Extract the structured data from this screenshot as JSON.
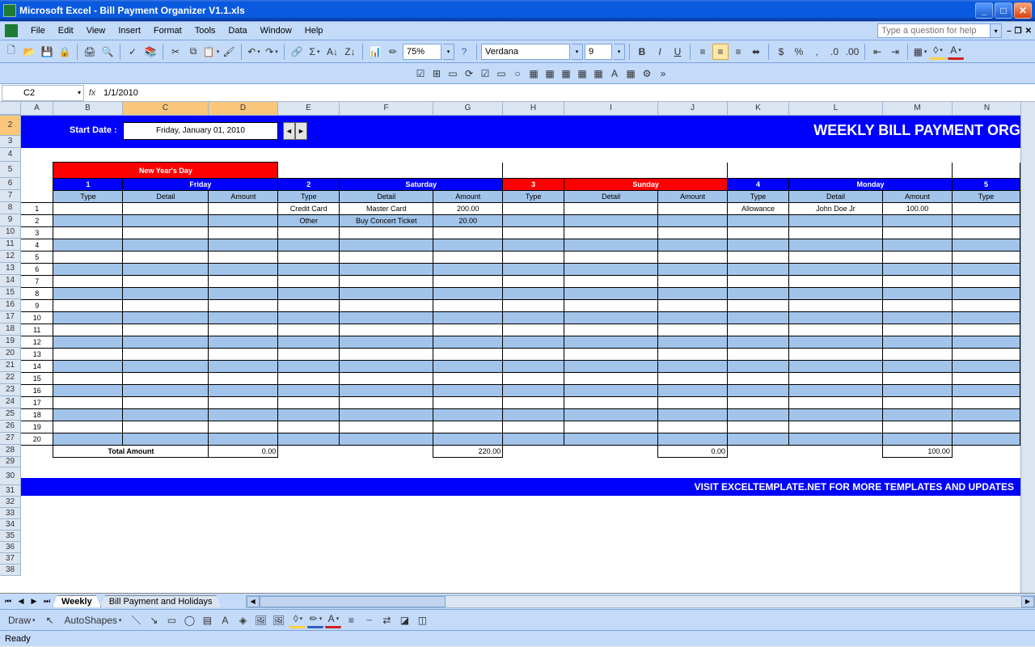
{
  "title": "Microsoft Excel - Bill Payment Organizer V1.1.xls",
  "menus": {
    "file": "File",
    "edit": "Edit",
    "view": "View",
    "insert": "Insert",
    "format": "Format",
    "tools": "Tools",
    "data": "Data",
    "window": "Window",
    "help": "Help"
  },
  "help_placeholder": "Type a question for help",
  "font_name": "Verdana",
  "font_size": "9",
  "zoom": "75%",
  "namebox": "C2",
  "formula": "1/1/2010",
  "columns": [
    "A",
    "B",
    "C",
    "D",
    "E",
    "F",
    "G",
    "H",
    "I",
    "J",
    "K",
    "L",
    "M",
    "N"
  ],
  "selected_cols": [
    "C",
    "D"
  ],
  "banner": {
    "start_label": "Start Date :",
    "start_value": "Friday, January 01, 2010",
    "title": "WEEKLY BILL PAYMENT ORG"
  },
  "holiday": {
    "col1": "New Year's Day"
  },
  "days": [
    {
      "num": "1",
      "name": "Friday",
      "weekend": false
    },
    {
      "num": "2",
      "name": "Saturday",
      "weekend": false
    },
    {
      "num": "3",
      "name": "Sunday",
      "weekend": true
    },
    {
      "num": "4",
      "name": "Monday",
      "weekend": false
    },
    {
      "num": "5",
      "name": "",
      "weekend": false
    }
  ],
  "subheaders": {
    "type": "Type",
    "detail": "Detail",
    "amount": "Amount"
  },
  "rows": [
    {
      "idx": "1",
      "c1": {
        "type": "",
        "detail": "",
        "amount": ""
      },
      "c2": {
        "type": "Credit Card",
        "detail": "Master Card",
        "amount": "200.00"
      },
      "c3": {
        "type": "",
        "detail": "",
        "amount": ""
      },
      "c4": {
        "type": "Allowance",
        "detail": "John Doe Jr",
        "amount": "100.00"
      },
      "c5": {
        "type": ""
      }
    },
    {
      "idx": "2",
      "c1": {
        "type": "",
        "detail": "",
        "amount": ""
      },
      "c2": {
        "type": "Other",
        "detail": "Buy Concert Ticket",
        "amount": "20.00"
      },
      "c3": {
        "type": "",
        "detail": "",
        "amount": ""
      },
      "c4": {
        "type": "",
        "detail": "",
        "amount": ""
      },
      "c5": {
        "type": ""
      }
    }
  ],
  "totals": {
    "label": "Total Amount",
    "a1": "0.00",
    "a2": "220.00",
    "a3": "0.00",
    "a4": "100.00"
  },
  "footer_link": "VISIT EXCELTEMPLATE.NET FOR MORE TEMPLATES AND UPDATES",
  "sheet_tabs": {
    "active": "Weekly",
    "other": "Bill Payment and Holidays"
  },
  "draw": {
    "label": "Draw",
    "autoshapes": "AutoShapes"
  },
  "status": "Ready"
}
